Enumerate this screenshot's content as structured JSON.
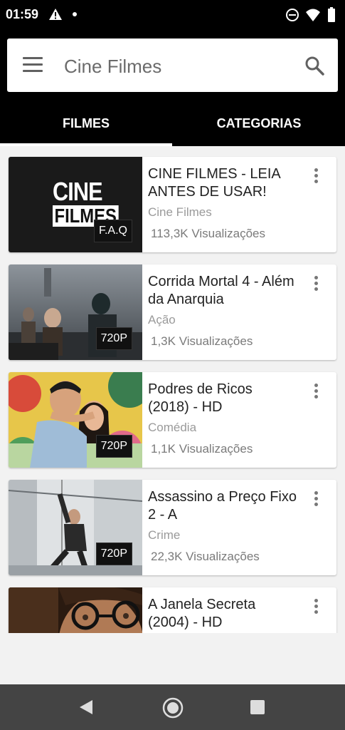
{
  "status_bar": {
    "time": "01:59",
    "icons": [
      "warning-icon",
      "notification-dot-icon",
      "do-not-disturb-icon",
      "wifi-icon",
      "battery-icon"
    ]
  },
  "app_bar": {
    "title": "Cine Filmes",
    "menu_icon": "menu-icon",
    "search_icon": "search-icon"
  },
  "tabs": [
    {
      "label": "FILMES",
      "selected": true
    },
    {
      "label": "CATEGORIAS",
      "selected": false
    }
  ],
  "movies": [
    {
      "title": "CINE FILMES - LEIA ANTES DE USAR!",
      "genre": "Cine Filmes",
      "views": "113,3K Visualizações",
      "badge": "F.A.Q",
      "logo_lines": [
        "CINE",
        "FILMES"
      ]
    },
    {
      "title": "Corrida Mortal 4 - Além da Anarquia",
      "genre": "Ação",
      "views": "1,3K Visualizações",
      "badge": "720P"
    },
    {
      "title": "Podres de Ricos (2018) - HD",
      "genre": "Comédia",
      "views": "1,1K Visualizações",
      "badge": "720P"
    },
    {
      "title": "Assassino a Preço Fixo 2 - A",
      "genre": "Crime",
      "views": "22,3K Visualizações",
      "badge": "720P"
    },
    {
      "title": "A Janela Secreta (2004) - HD",
      "genre": "",
      "views": "",
      "badge": ""
    }
  ],
  "nav_bar": {
    "icons": [
      "back-icon",
      "home-icon",
      "recents-icon"
    ]
  },
  "colors": {
    "app_bar": "#000000",
    "tab_indicator": "#ffffff",
    "list_background": "#f2f2f2",
    "nav_bar": "#444444"
  }
}
